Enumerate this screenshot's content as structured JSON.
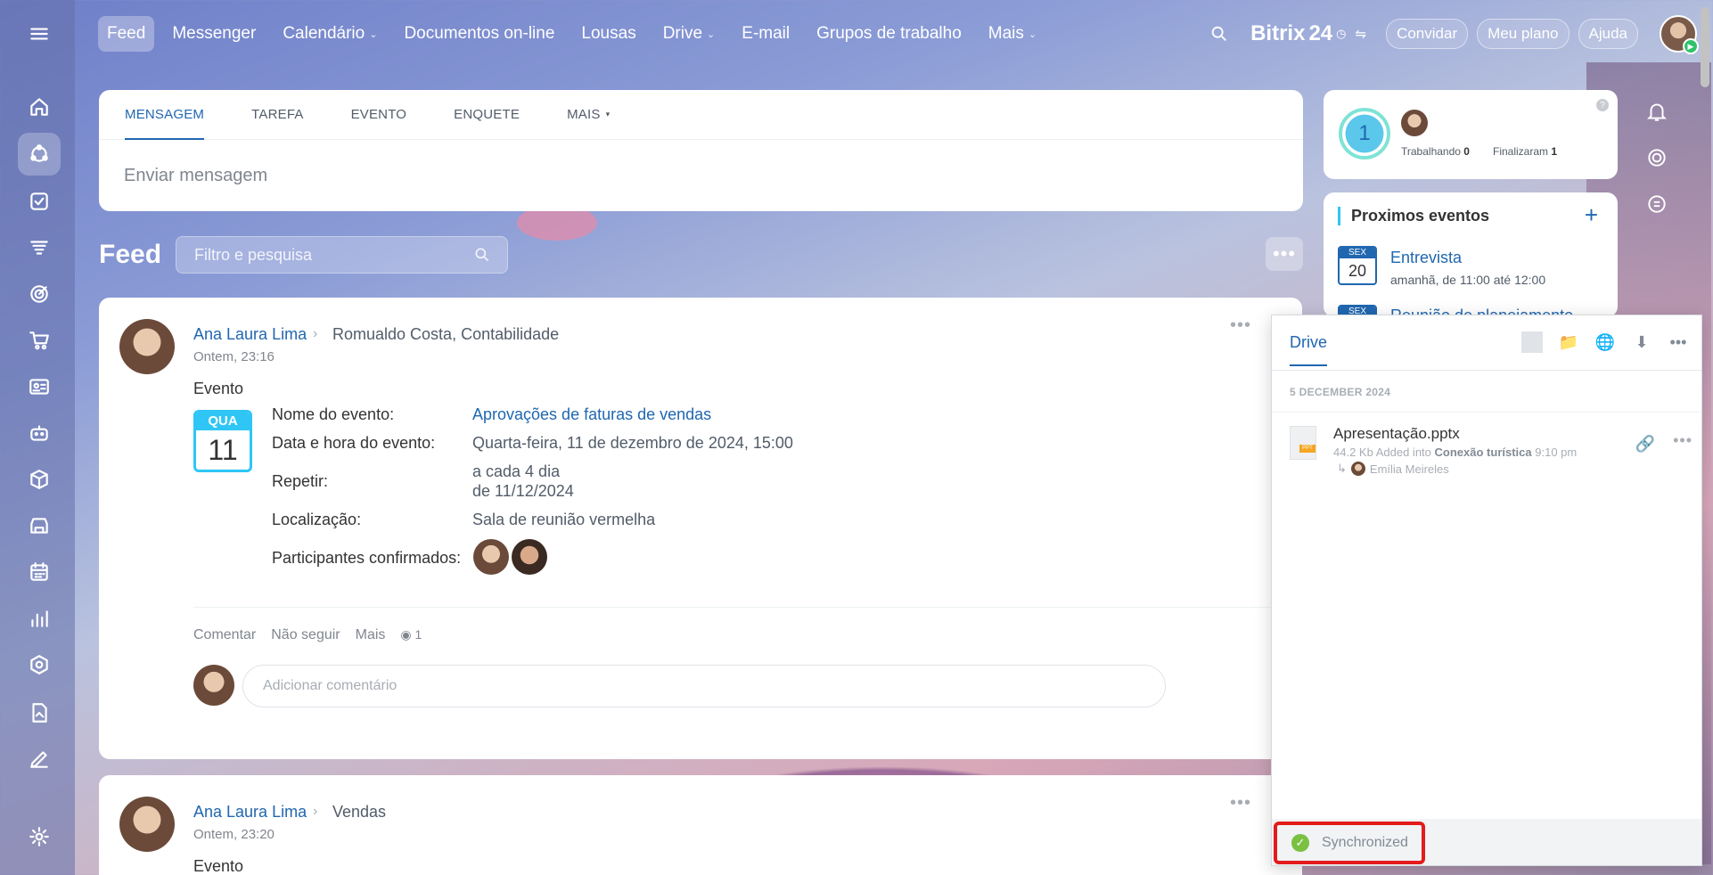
{
  "topnav": {
    "items": [
      {
        "label": "Feed",
        "active": true,
        "caret": false
      },
      {
        "label": "Messenger",
        "caret": false
      },
      {
        "label": "Calendário",
        "caret": true
      },
      {
        "label": "Documentos on-line",
        "caret": false
      },
      {
        "label": "Lousas",
        "caret": false
      },
      {
        "label": "Drive",
        "caret": true
      },
      {
        "label": "E-mail",
        "caret": false
      },
      {
        "label": "Grupos de trabalho",
        "caret": false
      },
      {
        "label": "Mais",
        "caret": true
      }
    ],
    "brand": "Bitrix",
    "brand_num": "24",
    "invite": "Convidar",
    "plan": "Meu plano",
    "help": "Ajuda"
  },
  "composer": {
    "tabs": [
      "MENSAGEM",
      "TAREFA",
      "EVENTO",
      "ENQUETE",
      "MAIS"
    ],
    "placeholder": "Enviar mensagem"
  },
  "feed": {
    "title": "Feed",
    "search_placeholder": "Filtro e pesquisa"
  },
  "post1": {
    "author": "Ana Laura Lima",
    "destination": "Romualdo Costa, Contabilidade",
    "time": "Ontem, 23:16",
    "type": "Evento",
    "cal_day_name": "QUA",
    "cal_day": "11",
    "fields": {
      "name_label": "Nome do evento:",
      "name_value": "Aprovações de faturas de vendas",
      "date_label": "Data e hora do evento:",
      "date_value": "Quarta-feira, 11 de dezembro de 2024, 15:00",
      "repeat_label": "Repetir:",
      "repeat_value1": "a cada 4 dia",
      "repeat_value2": "de 11/12/2024",
      "location_label": "Localização:",
      "location_value": "Sala de reunião vermelha",
      "participants_label": "Participantes confirmados:"
    },
    "actions": {
      "comment": "Comentar",
      "unfollow": "Não seguir",
      "more": "Mais",
      "views": "1"
    },
    "comment_placeholder": "Adicionar comentário"
  },
  "post2": {
    "author": "Ana Laura Lima",
    "destination": "Vendas",
    "time": "Ontem, 23:20",
    "type": "Evento"
  },
  "work_widget": {
    "count": "1",
    "working_label": "Trabalhando",
    "working_count": "0",
    "finished_label": "Finalizaram",
    "finished_count": "1"
  },
  "events": {
    "title": "Proximos eventos",
    "items": [
      {
        "day_name": "SEX",
        "day": "20",
        "name": "Entrevista",
        "sub": "amanhã, de 11:00 até 12:00"
      },
      {
        "day_name": "SEX",
        "day": "",
        "name": "Reunião de planejamento",
        "sub": ""
      }
    ]
  },
  "drive": {
    "tab": "Drive",
    "date_header": "5 DECEMBER 2024",
    "file": {
      "name": "Apresentação.pptx",
      "size": "44.2 Kb",
      "added_into": "Added into",
      "project": "Conexão turística",
      "time": "9:10 pm",
      "by": "Emília Meireles",
      "ext_tag": "PPT"
    },
    "sync_status": "Synchronized"
  }
}
